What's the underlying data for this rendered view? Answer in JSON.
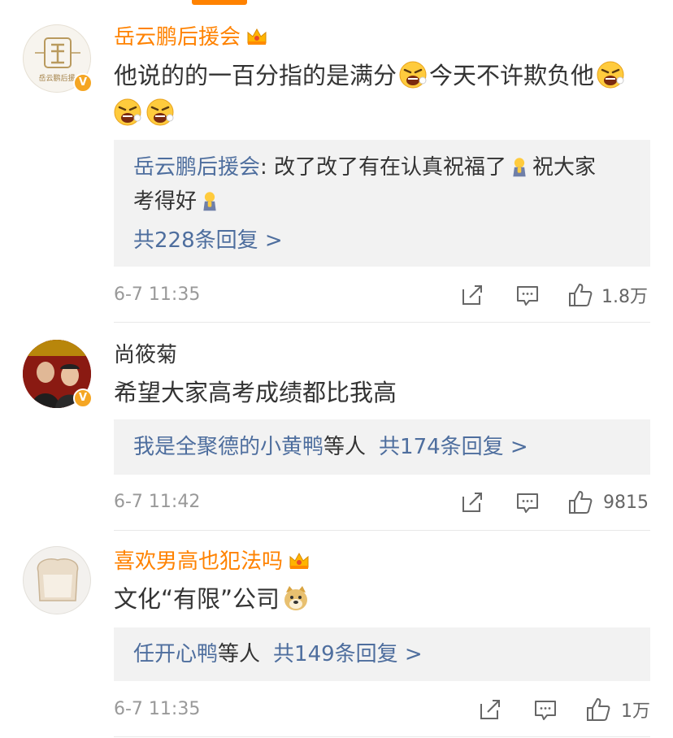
{
  "colors": {
    "vip_name": "#ff8200",
    "link": "#4e6e9e",
    "meta": "#999999",
    "reply_bg": "#f2f2f2",
    "badge": "#f5a623"
  },
  "comments": [
    {
      "username": "岳云鹏后援会",
      "avatar": "avatar-logo",
      "avatar_text": "岳云鹏后援",
      "text_parts": [
        "他说的的一百分指的是满分",
        "今天不许欺负他"
      ],
      "reply": {
        "author": "岳云鹏后援会",
        "text_a": ": 改了改了有在认真祝福了",
        "text_b": "祝大家",
        "text_c": "考得好",
        "more": "共228条回复 >"
      },
      "time": "6-7 11:35",
      "likes": "1.8万"
    },
    {
      "username": "尚筱菊",
      "avatar": "avatar-photo",
      "text": "希望大家高考成绩都比我高",
      "reply": {
        "author": "我是全聚德的小黄鸭",
        "suffix": "等人",
        "more": "共174条回复 >"
      },
      "time": "6-7 11:42",
      "likes": "9815"
    },
    {
      "username": "喜欢男高也犯法吗",
      "avatar": "avatar-bread",
      "text": "文化“有限”公司",
      "reply": {
        "author": "任开心鸭",
        "suffix": "等人",
        "more": "共149条回复 >"
      },
      "time": "6-7 11:35",
      "likes": "1万"
    }
  ],
  "icons": {
    "vip": "crown-icon",
    "angry": "angry-face-emoji",
    "pray": "pray-emoji",
    "doge": "doge-emoji",
    "share": "share-icon",
    "comment": "comment-icon",
    "like": "thumbs-up-icon",
    "verified": "verified-badge-icon"
  },
  "verified_mark": "V"
}
